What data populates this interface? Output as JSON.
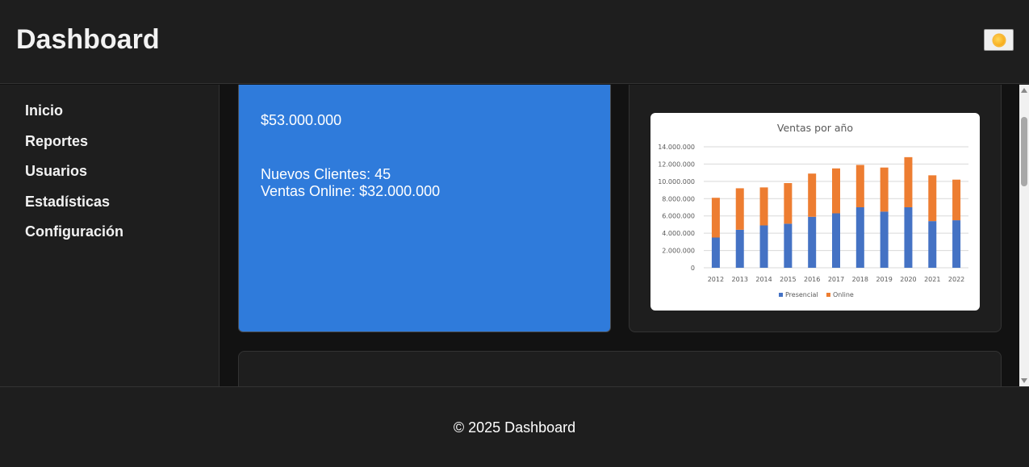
{
  "header": {
    "title": "Dashboard",
    "theme_toggle_icon": "sun-icon"
  },
  "sidebar": {
    "items": [
      {
        "label": "Inicio"
      },
      {
        "label": "Reportes"
      },
      {
        "label": "Usuarios"
      },
      {
        "label": "Estadísticas"
      },
      {
        "label": "Configuración"
      }
    ]
  },
  "cards": {
    "sales": {
      "amount": "$53.000.000",
      "new_clients": "Nuevos Clientes: 45",
      "online_sales": "Ventas Online: $32.000.000"
    }
  },
  "chart_data": {
    "type": "bar",
    "stacked": true,
    "title": "Ventas por año",
    "xlabel": "",
    "ylabel": "",
    "categories": [
      "2012",
      "2013",
      "2014",
      "2015",
      "2016",
      "2017",
      "2018",
      "2019",
      "2020",
      "2021",
      "2022"
    ],
    "series": [
      {
        "name": "Presencial",
        "color": "#4472c4",
        "values": [
          3500000,
          4400000,
          4900000,
          5100000,
          5900000,
          6300000,
          7000000,
          6500000,
          7000000,
          5400000,
          5500000
        ]
      },
      {
        "name": "Online",
        "color": "#ed7d31",
        "values": [
          4600000,
          4800000,
          4400000,
          4700000,
          5000000,
          5200000,
          4900000,
          5100000,
          5800000,
          5300000,
          4700000
        ]
      }
    ],
    "ylim": [
      0,
      14000000
    ],
    "yticks": [
      "0",
      "2.000.000",
      "4.000.000",
      "6.000.000",
      "8.000.000",
      "10.000.000",
      "12.000.000",
      "14.000.000"
    ],
    "grid": true,
    "legend": "bottom"
  },
  "footer": {
    "text": "© 2025 Dashboard"
  },
  "colors": {
    "accent": "#2f7bdb",
    "background": "#121212",
    "panel": "#1e1e1e"
  }
}
